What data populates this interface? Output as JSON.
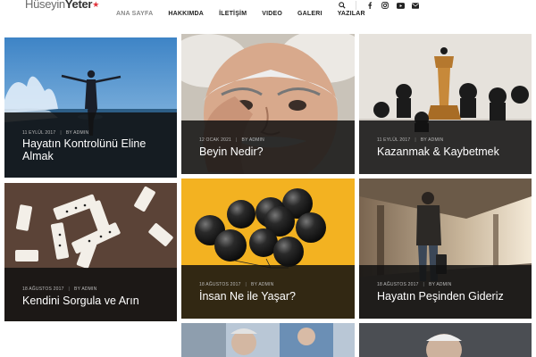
{
  "brand": {
    "first": "Hüseyin",
    "last": "Yeter",
    "mark": "★"
  },
  "nav": [
    {
      "label": "ANA SAYFA",
      "active": true
    },
    {
      "label": "HAKKIMDA"
    },
    {
      "label": "İLETİŞİM"
    },
    {
      "label": "VIDEO"
    },
    {
      "label": "GALERI"
    },
    {
      "label": "YAZILAR"
    }
  ],
  "header_icons": [
    "search-icon",
    "facebook-icon",
    "instagram-icon",
    "youtube-icon",
    "email-icon"
  ],
  "posts": [
    {
      "date": "11 EYLÜL 2017",
      "author": "BY ADMIN",
      "title_line1": "Hayatın Kontrolünü Eline",
      "title_line2": "Almak",
      "image": "person-arms-open-at-sea"
    },
    {
      "date": "12 OCAK 2021",
      "author": "BY ADMIN",
      "title_line1": "Beyin Nedir?",
      "image": "einstein-portrait"
    },
    {
      "date": "11 EYLÜL 2017",
      "author": "BY ADMIN",
      "title_line1": "Kazanmak & Kaybetmek",
      "image": "chess-pieces"
    },
    {
      "date": "18 AĞUSTOS 2017",
      "author": "BY ADMIN",
      "title_line1": "Kendini Sorgula ve Arın",
      "image": "dominoes"
    },
    {
      "date": "18 AĞUSTOS 2017",
      "author": "BY ADMIN",
      "title_line1": "İnsan Ne ile Yaşar?",
      "image": "black-balloons"
    },
    {
      "date": "18 AĞUSTOS 2017",
      "author": "BY ADMIN",
      "title_line1": "Hayatın Peşinden Gideriz",
      "image": "man-with-suitcase-station"
    },
    {
      "image": "elderly-people"
    },
    {
      "image": "elderly-woman"
    }
  ],
  "colors": {
    "accent": "#e2343c",
    "overlay": "#121212"
  }
}
